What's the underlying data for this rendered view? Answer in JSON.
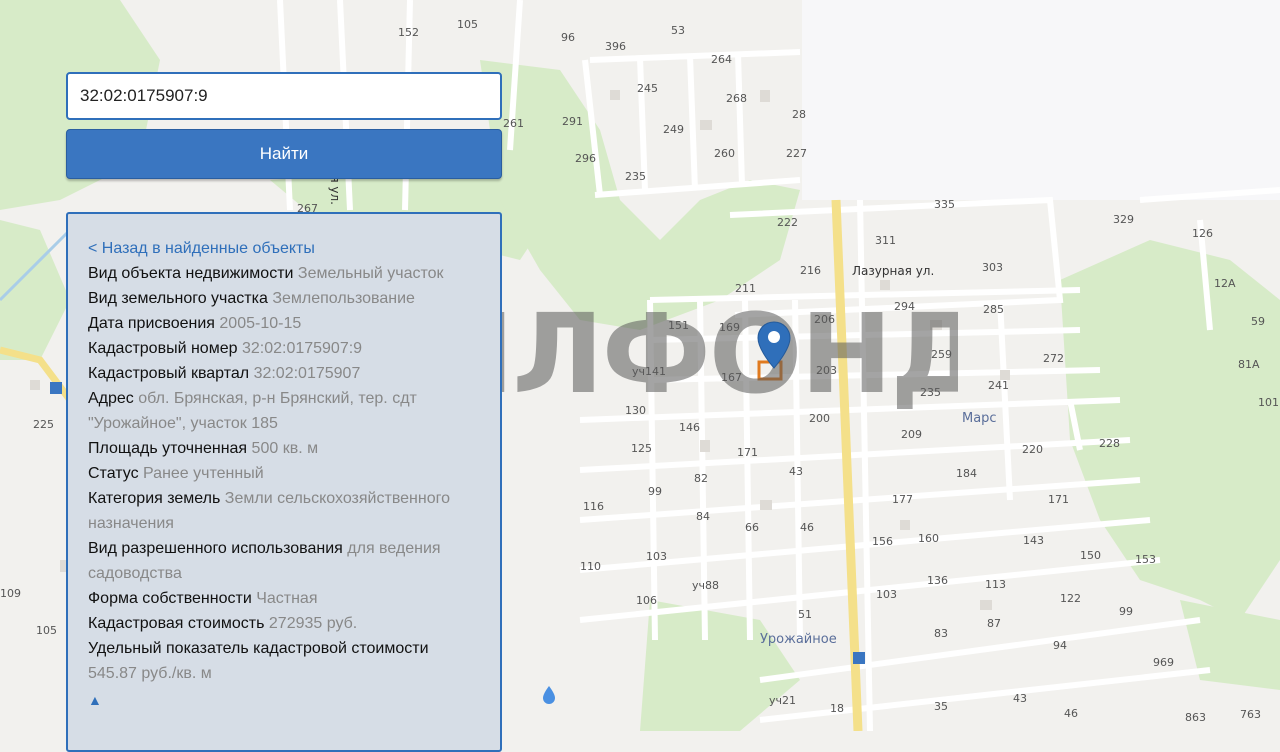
{
  "search": {
    "value": "32:02:0175907:9"
  },
  "find_button": {
    "label": "Найти"
  },
  "info": {
    "back_link": "< Назад в найденные объекты",
    "fields": [
      {
        "key": "Вид объекта недвижимости",
        "value": "Земельный участок"
      },
      {
        "key": "Вид земельного участка",
        "value": "Землепользование"
      },
      {
        "key": "Дата присвоения",
        "value": "2005-10-15"
      },
      {
        "key": "Кадастровый номер",
        "value": "32:02:0175907:9"
      },
      {
        "key": "Кадастровый квартал",
        "value": "32:02:0175907"
      },
      {
        "key": "Адрес",
        "value": "обл. Брянская, р-н Брянский, тер. сдт \"Урожайное\", участок 185"
      },
      {
        "key": "Площадь уточненная",
        "value": "500 кв. м"
      },
      {
        "key": "Статус",
        "value": "Ранее учтенный"
      },
      {
        "key": "Категория земель",
        "value": "Земли сельскохозяйственного назначения"
      },
      {
        "key": "Вид разрешенного использования",
        "value": "для ведения садоводства"
      },
      {
        "key": "Форма собственности",
        "value": "Частная"
      },
      {
        "key": "Кадастровая стоимость",
        "value": "272935 руб."
      },
      {
        "key": "Удельный показатель кадастровой стоимости",
        "value": "545.87 руб./кв. м"
      }
    ],
    "scroll_up_icon": "▲"
  },
  "watermark": {
    "text": "ЖИЛФОНД"
  },
  "map": {
    "streets": {
      "lazurnaya": "Лазурная ул.",
      "vertical": "ая ул."
    },
    "places": {
      "mars": "Марс",
      "urozhaynoe": "Урожайное"
    },
    "house_numbers": {
      "n152": "152",
      "n105a": "105",
      "n96": "96",
      "n396": "396",
      "n53": "53",
      "n264": "264",
      "n245": "245",
      "n268": "268",
      "n28": "28",
      "n291": "291",
      "n249": "249",
      "n261": "261",
      "n296": "296",
      "n260": "260",
      "n227": "227",
      "n235a": "235",
      "n267": "267",
      "n335": "335",
      "n329": "329",
      "n222": "222",
      "n311": "311",
      "n126": "126",
      "n216": "216",
      "n303": "303",
      "n211": "211",
      "n12a": "12А",
      "n294": "294",
      "n151": "151",
      "n169": "169",
      "n206": "206",
      "n285": "285",
      "n59": "59",
      "n259": "259",
      "n272": "272",
      "n81a": "81А",
      "u141": "уч141",
      "n167": "167",
      "n203": "203",
      "n241": "241",
      "n235b": "235",
      "n101": "101",
      "n225": "225",
      "n130": "130",
      "n200": "200",
      "n146": "146",
      "n209": "209",
      "n228": "228",
      "n125": "125",
      "n171a": "171",
      "n220": "220",
      "n43a": "43",
      "n184": "184",
      "n99a": "99",
      "n82": "82",
      "n177": "177",
      "n171b": "171",
      "n116": "116",
      "n84": "84",
      "n66": "66",
      "n46a": "46",
      "n156": "156",
      "n160": "160",
      "n143": "143",
      "n103a": "103",
      "n150": "150",
      "n153": "153",
      "n110": "110",
      "u88": "уч88",
      "n136": "136",
      "n113": "113",
      "n109": "109",
      "n103b": "103",
      "n122": "122",
      "n106": "106",
      "n51": "51",
      "n99b": "99",
      "n105b": "105",
      "n83": "83",
      "n87": "87",
      "n94": "94",
      "n969": "969",
      "u21": "уч21",
      "n18": "18",
      "n35": "35",
      "n43b": "43",
      "n46b": "46",
      "n863": "863",
      "n763": "763"
    }
  },
  "colors": {
    "accent": "#2f6fba",
    "button": "#3a76c1",
    "panel": "#d6dde6",
    "marker": "#2f6fba",
    "plot_outline": "#e07a1f",
    "road": "#f4e08a"
  }
}
